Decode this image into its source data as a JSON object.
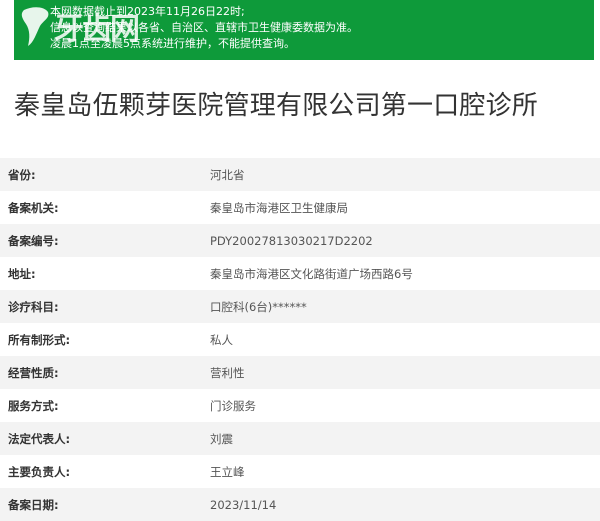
{
  "notice": {
    "lines": [
      "本网数据截止到2023年11月26日22时;",
      "信息以查询结果以各省、自治区、直辖市卫生健康委数据为准。",
      "凌晨1点至凌晨5点系统进行维护，不能提供查询。"
    ],
    "watermark_text": "牙齿网",
    "bg_color": "#0e9a3a"
  },
  "page_title": "秦皇岛伍颗芽医院管理有限公司第一口腔诊所",
  "fields": [
    {
      "label": "省份:",
      "value": "河北省"
    },
    {
      "label": "备案机关:",
      "value": "秦皇岛市海港区卫生健康局"
    },
    {
      "label": "备案编号:",
      "value": "PDY20027813030217D2202"
    },
    {
      "label": "地址:",
      "value": "秦皇岛市海港区文化路街道广场西路6号"
    },
    {
      "label": "诊疗科目:",
      "value": "口腔科(6台)******"
    },
    {
      "label": "所有制形式:",
      "value": "私人"
    },
    {
      "label": "经营性质:",
      "value": "营利性"
    },
    {
      "label": "服务方式:",
      "value": "门诊服务"
    },
    {
      "label": "法定代表人:",
      "value": "刘震"
    },
    {
      "label": "主要负责人:",
      "value": "王立峰"
    },
    {
      "label": "备案日期:",
      "value": "2023/11/14"
    }
  ]
}
